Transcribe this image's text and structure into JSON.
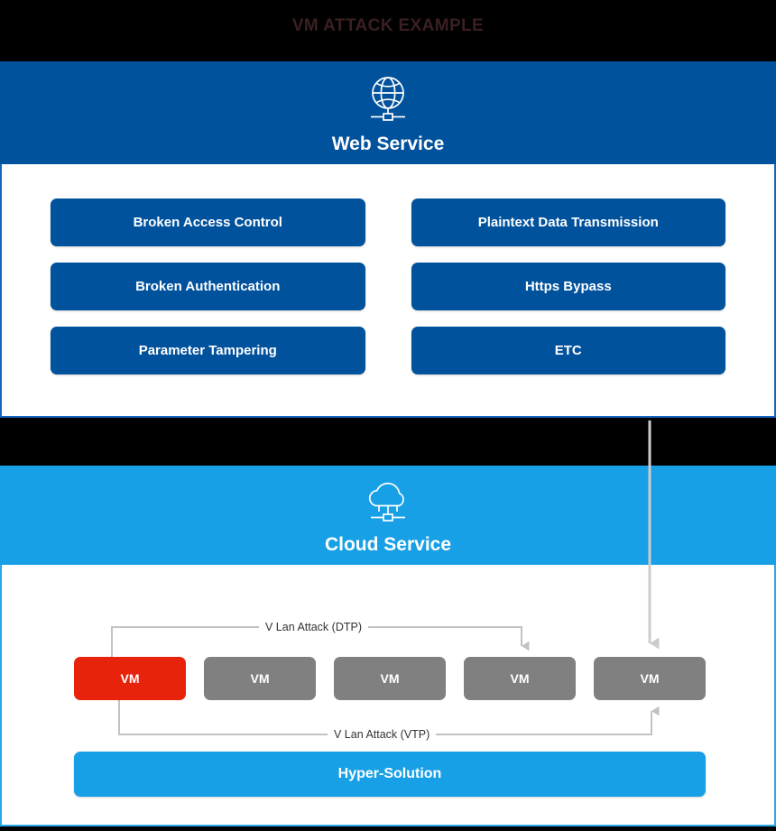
{
  "page": {
    "title": "VM ATTACK EXAMPLE",
    "title_color": "#3a2020",
    "background_color": "#000000"
  },
  "web_service": {
    "label": "Web Service",
    "icon": "globe-network-icon",
    "header_color": "#01529c",
    "panel_border_color": "#1665c0",
    "threats": [
      {
        "label": "Broken Access Control",
        "column": "left"
      },
      {
        "label": "Plaintext Data Transmission",
        "column": "right"
      },
      {
        "label": "Broken Authentication",
        "column": "left"
      },
      {
        "label": "Https Bypass",
        "column": "right"
      },
      {
        "label": "Parameter Tampering",
        "column": "left"
      },
      {
        "label": "ETC",
        "column": "right"
      }
    ],
    "button_color": "#01529c"
  },
  "cloud_service": {
    "label": "Cloud Service",
    "icon": "cloud-network-icon",
    "header_color": "#18a0e6",
    "panel_border_color": "#29a8e8",
    "vms": [
      {
        "label": "VM",
        "state": "attacked",
        "color": "#e8230c"
      },
      {
        "label": "VM",
        "state": "normal",
        "color": "#808080"
      },
      {
        "label": "VM",
        "state": "normal",
        "color": "#808080"
      },
      {
        "label": "VM",
        "state": "normal",
        "color": "#808080"
      },
      {
        "label": "VM",
        "state": "normal",
        "color": "#808080"
      }
    ],
    "flows": [
      {
        "label": "V Lan Attack (DTP)",
        "from": "vm-1",
        "to": "vm-4",
        "position": "above"
      },
      {
        "label": "V Lan Attack (VTP)",
        "from": "vm-1",
        "to": "vm-5",
        "position": "below"
      }
    ],
    "hypervisor": {
      "label": "Hyper-Solution",
      "color": "#18a0e6"
    }
  },
  "connector": {
    "label": "",
    "from": "web-service-panel",
    "to": "vm-5",
    "color": "#cccccc"
  }
}
